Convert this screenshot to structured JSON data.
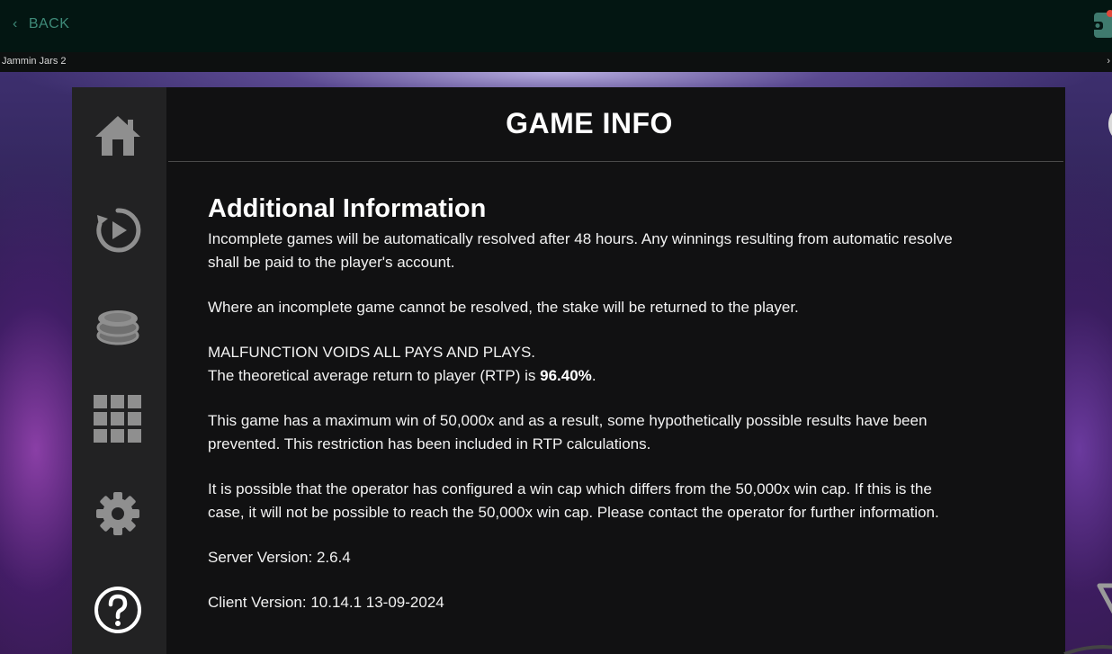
{
  "topbar": {
    "back_label": "BACK",
    "game_title": "Jammin Jars 2",
    "strip_glyph": "›"
  },
  "sidebar": {
    "items": [
      {
        "icon": "home-icon"
      },
      {
        "icon": "replay-icon"
      },
      {
        "icon": "coins-icon"
      },
      {
        "icon": "grid-icon"
      },
      {
        "icon": "gear-icon"
      },
      {
        "icon": "help-icon"
      }
    ]
  },
  "header": {
    "title": "GAME INFO",
    "close_icon": "close-icon"
  },
  "content": {
    "heading": "Additional Information",
    "p1": "Incomplete games will be automatically resolved after 48 hours. Any winnings resulting from automatic resolve shall be paid to the player's account.",
    "p2": "Where an incomplete game cannot be resolved, the stake will be returned to the player.",
    "p3_line1": "MALFUNCTION VOIDS ALL PAYS AND PLAYS.",
    "p3_line2_prefix": "The theoretical average return to player (RTP) is ",
    "rtp_value": "96.40%",
    "p3_line2_suffix": ".",
    "p4": "This game has a maximum win of 50,000x and as a result, some hypothetically possible results have been prevented. This restriction has been included in RTP calculations.",
    "p5": "It is possible that the operator has configured a win cap which differs from the 50,000x win cap. If this is the case, it will not be possible to reach the 50,000x win cap. Please contact the operator for further information.",
    "server_version": "Server Version: 2.6.4",
    "client_version": "Client Version: 10.14.1 13-09-2024"
  },
  "colors": {
    "back_text": "#3e8a78",
    "panel": "#161617",
    "sidebar": "#222223",
    "icon_gray": "#8f8f8f"
  }
}
